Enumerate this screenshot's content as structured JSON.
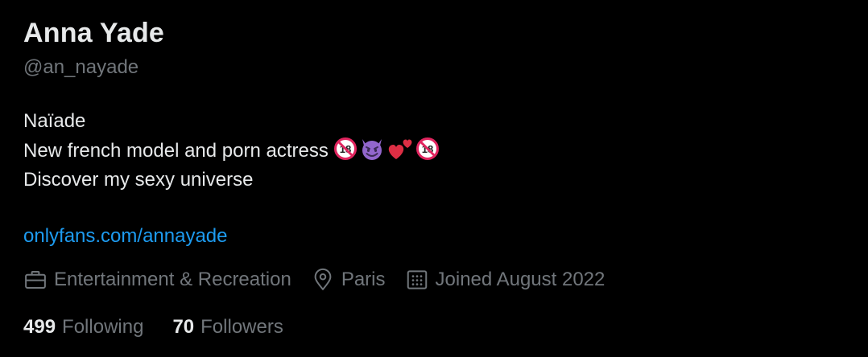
{
  "profile": {
    "display_name": "Anna Yade",
    "handle": "@an_nayade",
    "bio": {
      "line1": "Naïade",
      "line2": "New french model and porn actress",
      "line2_emojis": [
        "no-one-under-eighteen-icon",
        "smiling-devil-icon",
        "two-hearts-icon",
        "no-one-under-eighteen-icon"
      ],
      "line3": "Discover my sexy universe"
    },
    "link": "onlyfans.com/annayade",
    "meta": {
      "category": "Entertainment & Recreation",
      "location": "Paris",
      "joined": "Joined August 2022"
    },
    "following": {
      "count": "499",
      "label": "Following"
    },
    "followers": {
      "count": "70",
      "label": "Followers"
    }
  },
  "colors": {
    "background": "#000000",
    "primary_text": "#e7e9ea",
    "secondary_text": "#71767b",
    "link": "#1d9bf0"
  }
}
